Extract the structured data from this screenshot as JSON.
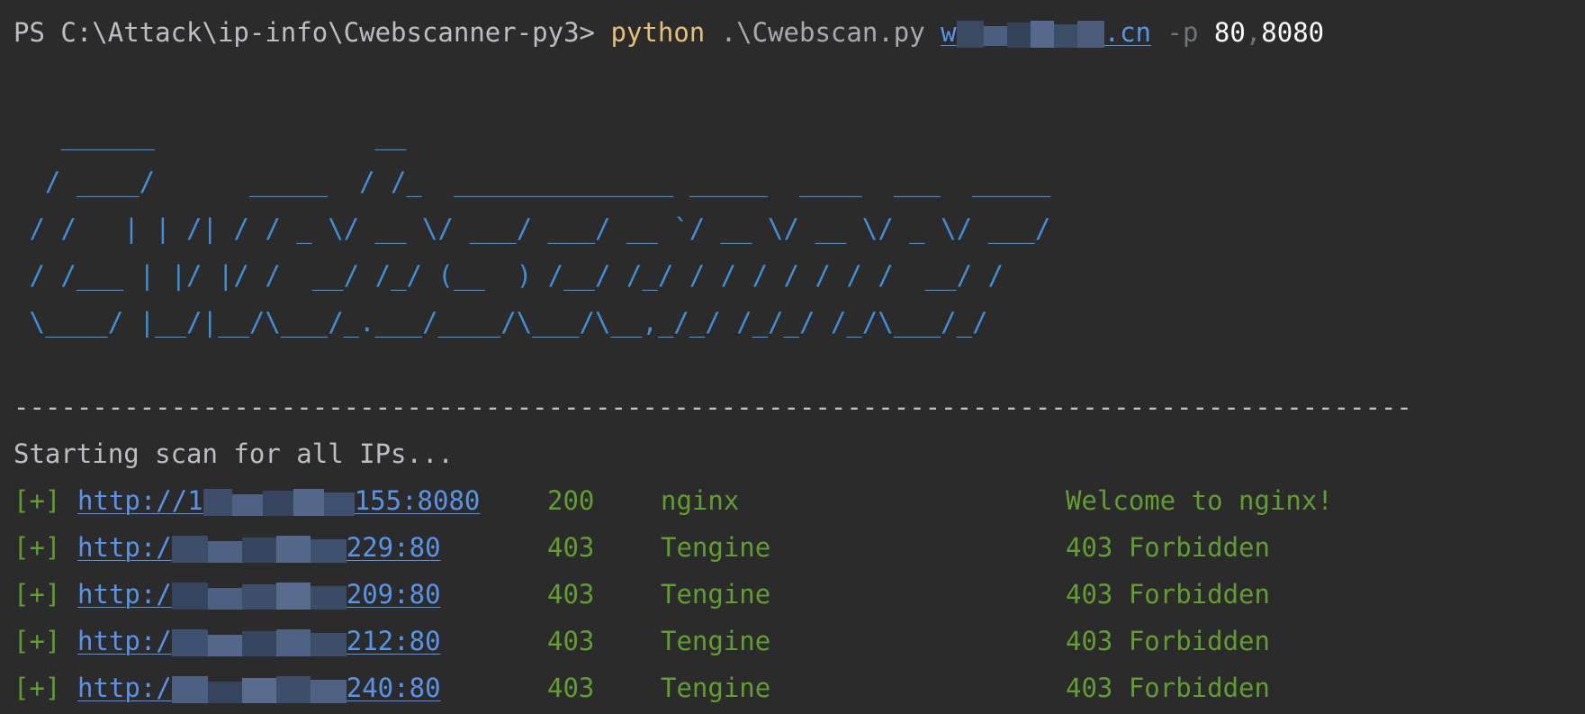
{
  "command": {
    "prompt": "PS C:\\Attack\\ip-info\\Cwebscanner-py3>",
    "program": "python",
    "script": ".\\Cwebscan.py",
    "target_prefix": "w",
    "target_suffix": ".cn",
    "flag": "-p",
    "port1": "80",
    "comma": ",",
    "port2": "8080"
  },
  "banner": [
    "   ______              __",
    "  / ____/      _____  / /_  ______________ _____  ____  ___  _____",
    " / /   | | /| / / _ \\/ __ \\/ ___/ ___/ __ `/ __ \\/ __ \\/ _ \\/ ___/",
    " / /___ | |/ |/ /  __/ /_/ (__  ) /__/ /_/ / / / / / / /  __/ /",
    " \\____/ |__/|__/\\___/_.___/____/\\___/\\__,_/_/ /_/_/ /_/\\___/_/"
  ],
  "divider": "-----------------------------------------------------------------------------------------",
  "status_text": "Starting scan for all IPs...",
  "results": [
    {
      "marker": "[+]",
      "url_prefix": "http://1",
      "url_suffix": "155:8080",
      "code": "200",
      "server": "nginx",
      "title": "Welcome to nginx!"
    },
    {
      "marker": "[+]",
      "url_prefix": "http:/",
      "url_suffix": "229:80",
      "code": "403",
      "server": "Tengine",
      "title": "403 Forbidden"
    },
    {
      "marker": "[+]",
      "url_prefix": "http:/",
      "url_suffix": "209:80",
      "code": "403",
      "server": "Tengine",
      "title": "403 Forbidden"
    },
    {
      "marker": "[+]",
      "url_prefix": "http:/",
      "url_suffix": "212:80",
      "code": "403",
      "server": "Tengine",
      "title": "403 Forbidden"
    },
    {
      "marker": "[+]",
      "url_prefix": "http:/",
      "url_suffix": "240:80",
      "code": "403",
      "server": "Tengine",
      "title": "403 Forbidden"
    }
  ],
  "colors": {
    "background": "#2b2b2b",
    "command": "#e5c07b",
    "link": "#5895e8",
    "banner": "#3f8fd9",
    "success": "#5f9e2f"
  }
}
